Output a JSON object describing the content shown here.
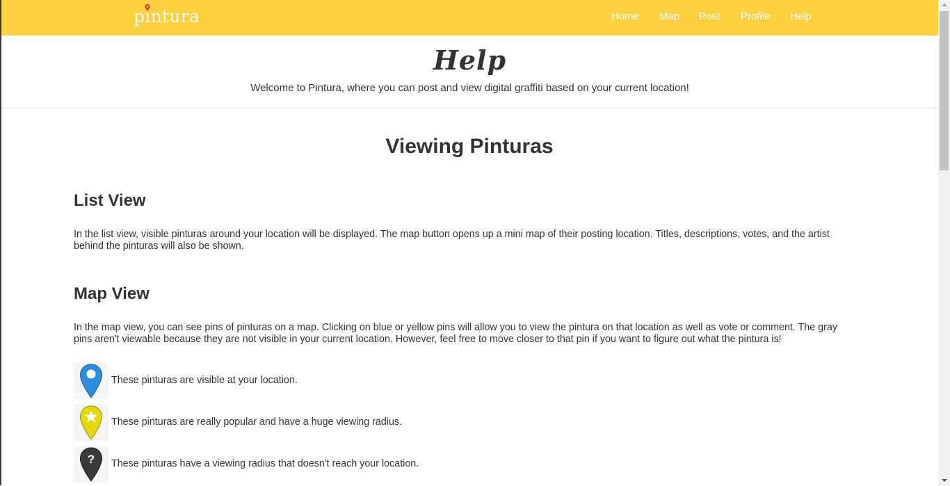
{
  "nav": {
    "brand": "pintura",
    "links": [
      "Home",
      "Map",
      "Post",
      "Profile",
      "Help"
    ],
    "accent": "#fcd03f"
  },
  "header": {
    "title": "Help",
    "welcome": "Welcome to Pintura, where you can post and view digital graffiti based on your current location!"
  },
  "main": {
    "section_title": "Viewing Pinturas",
    "list_view": {
      "heading": "List View",
      "body": "In the list view, visible pinturas around your location will be displayed. The map button opens up a mini map of their posting location. Titles, descriptions, votes, and the artist behind the pinturas will also be shown."
    },
    "map_view": {
      "heading": "Map View",
      "body": "In the map view, you can see pins of pinturas on a map. Clicking on blue or yellow pins will allow you to view the pintura on that location as well as vote or comment. The gray pins aren't viewable because they are not visible in your current location. However, feel free to move closer to that pin if you want to figure out what the pintura is!"
    },
    "legend": [
      {
        "icon": "blue-pin-icon",
        "color": "#2b8ee0",
        "text": "These pinturas are visible at your location."
      },
      {
        "icon": "yellow-star-pin-icon",
        "color": "#e5d80f",
        "text": "These pinturas are really popular and have a huge viewing radius."
      },
      {
        "icon": "dark-question-pin-icon",
        "color": "#3a3a3a",
        "text": "These pinturas have a viewing radius that doesn't reach your location."
      }
    ]
  }
}
